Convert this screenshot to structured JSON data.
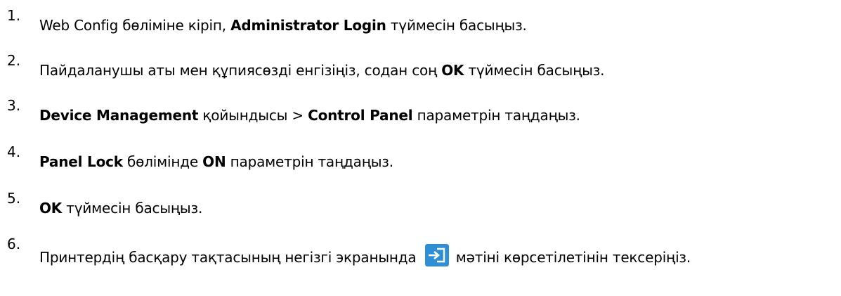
{
  "steps": [
    {
      "number": "1.",
      "parts": [
        {
          "t": "Web Config бөліміне кіріп, ",
          "b": false
        },
        {
          "t": "Administrator Login",
          "b": true
        },
        {
          "t": " түймесін басыңыз.",
          "b": false
        }
      ]
    },
    {
      "number": "2.",
      "parts": [
        {
          "t": "Пайдаланушы аты мен құпиясөзді енгізіңіз, содан соң ",
          "b": false
        },
        {
          "t": "OK",
          "b": true
        },
        {
          "t": " түймесін басыңыз.",
          "b": false
        }
      ]
    },
    {
      "number": "3.",
      "parts": [
        {
          "t": "Device Management",
          "b": true
        },
        {
          "t": " қойындысы > ",
          "b": false
        },
        {
          "t": "Control Panel",
          "b": true
        },
        {
          "t": " параметрін таңдаңыз.",
          "b": false
        }
      ]
    },
    {
      "number": "4.",
      "parts": [
        {
          "t": "Panel Lock",
          "b": true
        },
        {
          "t": " бөлімінде ",
          "b": false
        },
        {
          "t": "ON",
          "b": true
        },
        {
          "t": " параметрін таңдаңыз.",
          "b": false
        }
      ]
    },
    {
      "number": "5.",
      "parts": [
        {
          "t": "OK",
          "b": true
        },
        {
          "t": " түймесін басыңыз.",
          "b": false
        }
      ]
    },
    {
      "number": "6.",
      "parts": [
        {
          "t": "Принтердің басқару тақтасының негізгі экранында ",
          "b": false
        },
        {
          "icon": "login-icon"
        },
        {
          "t": " мәтіні көрсетілетінін тексеріңіз.",
          "b": false
        }
      ]
    }
  ],
  "colors": {
    "text": "#000000",
    "icon_bg": "#2f8fd6",
    "icon_fg": "#ffffff"
  }
}
